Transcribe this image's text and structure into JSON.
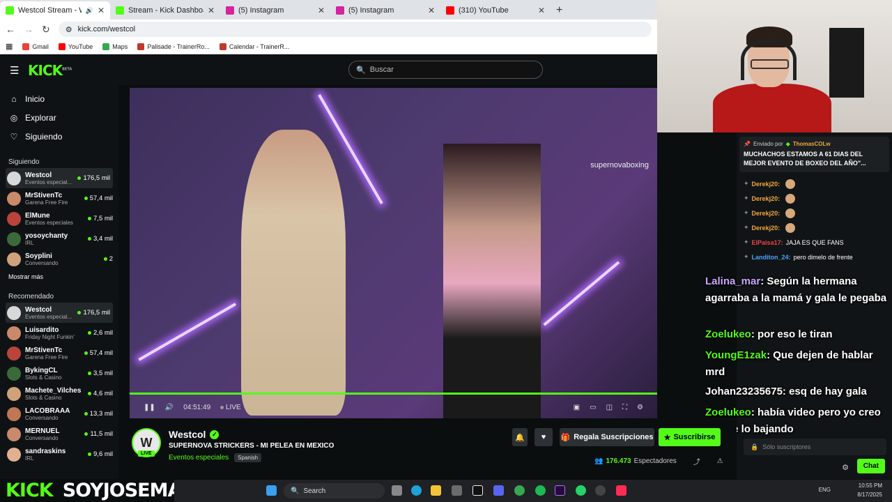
{
  "browser": {
    "tabs": [
      {
        "title": "Westcol Stream - Watch Li...",
        "color": "#53fc18",
        "active": true
      },
      {
        "title": "Stream - Kick Dashboard",
        "color": "#53fc18",
        "active": false
      },
      {
        "title": "(5) Instagram",
        "color": "#d6249f",
        "active": false
      },
      {
        "title": "(5) Instagram",
        "color": "#d6249f",
        "active": false
      },
      {
        "title": "(310) YouTube",
        "color": "#ff0000",
        "active": false
      }
    ],
    "url": "kick.com/westcol",
    "bookmarks": [
      "Gmail",
      "YouTube",
      "Maps",
      "Palisade - TrainerRo...",
      "Calendar - TrainerR..."
    ]
  },
  "header": {
    "logo": "KICK",
    "beta": "BETA",
    "search_placeholder": "Buscar"
  },
  "sidebar": {
    "nav": [
      {
        "label": "Inicio",
        "icon": "home-icon"
      },
      {
        "label": "Explorar",
        "icon": "compass-icon"
      },
      {
        "label": "Siguiendo",
        "icon": "heart-icon"
      }
    ],
    "following_title": "Siguiendo",
    "following": [
      {
        "name": "Westcol",
        "category": "Eventos especial...",
        "viewers": "176,5 mil",
        "selected": true
      },
      {
        "name": "MrStivenTc",
        "category": "Garena Free Fire",
        "viewers": "57,4 mil"
      },
      {
        "name": "ElMune",
        "category": "Eventos especiales",
        "viewers": "7,5 mil"
      },
      {
        "name": "yosoychanty",
        "category": "IRL",
        "viewers": "3,4 mil"
      },
      {
        "name": "Soyplini",
        "category": "Conversando",
        "viewers": "2"
      }
    ],
    "show_more": "Mostrar más",
    "recommended_title": "Recomendado",
    "recommended": [
      {
        "name": "Westcol",
        "category": "Eventos especial...",
        "viewers": "176,5 mil",
        "selected": true
      },
      {
        "name": "Luisardito",
        "category": "Friday Night Funkin'",
        "viewers": "2,6 mil"
      },
      {
        "name": "MrStivenTc",
        "category": "Garena Free Fire",
        "viewers": "57,4 mil"
      },
      {
        "name": "BykingCL",
        "category": "Slots & Casino",
        "viewers": "3,5 mil"
      },
      {
        "name": "Machete_Vilches",
        "category": "Slots & Casino",
        "viewers": "4,6 mil"
      },
      {
        "name": "LACOBRAAA",
        "category": "Conversando",
        "viewers": "13,3 mil"
      },
      {
        "name": "MERNUEL",
        "category": "Conversando",
        "viewers": "11,5 mil"
      },
      {
        "name": "sandraskins",
        "category": "IRL",
        "viewers": "9,6 mil"
      }
    ]
  },
  "player": {
    "time": "04:51:49",
    "live_label": "LIVE",
    "overlay_handle": "supernovaboxing"
  },
  "stream": {
    "name": "Westcol",
    "title": "SUPERNOVA STRICKERS - MI PELEA EN MEXICO",
    "category": "Eventos especiales",
    "tag": "Spanish",
    "live": "LIVE",
    "gift_label": "Regala Suscripciones",
    "subscribe_label": "Suscribirse",
    "viewers_count": "176.473",
    "viewers_label": "Espectadores"
  },
  "chat": {
    "pinned_sent_by": "Enviado por",
    "pinned_user": "ThomasCOLw",
    "pinned_message": "MUCHACHOS ESTAMOS A 61 DIAS DEL MEJOR EVENTO DE BOXEO DEL AÑO\"...",
    "messages": [
      {
        "user": "Derekj20:",
        "text": "",
        "color": "#f2a83b"
      },
      {
        "user": "Derekj20:",
        "text": "",
        "color": "#f2a83b"
      },
      {
        "user": "Derekj20:",
        "text": "",
        "color": "#f2a83b"
      },
      {
        "user": "Derekj20:",
        "text": "",
        "color": "#f2a83b"
      },
      {
        "user": "ElPaisa17:",
        "text": "JAJA ES QUE FANS",
        "color": "#e84545"
      },
      {
        "user": "Landiton_24:",
        "text": "pero dimelo de frente",
        "color": "#4aa3ff"
      }
    ],
    "overlay": [
      {
        "user": "Lalina_mar",
        "text": ": Según la hermana agarraba a la mamá y gala le pegaba",
        "color": "#c9a6ff"
      },
      {
        "user": "Zoelukeo",
        "text": ": por eso le tiran",
        "color": "#53fc18"
      },
      {
        "user": "YoungE1zak",
        "text": ": Que dejen de hablar mrd",
        "color": "#53fc18"
      },
      {
        "user": "Johan23235675",
        "text": ": esq de hay gala",
        "color": "#fff"
      },
      {
        "user": "Zoelukeo",
        "text": ": había video pero yo creo que se lo bajando",
        "color": "#53fc18"
      }
    ],
    "input_placeholder": "Sólo suscriptores",
    "chat_button": "Chat"
  },
  "footer_text": {
    "left": "KICK",
    "right": "SOYJOSEMA"
  },
  "taskbar": {
    "search": "Search",
    "lang": "ENG",
    "time": "10:55 PM",
    "date": "8/17/2025"
  }
}
